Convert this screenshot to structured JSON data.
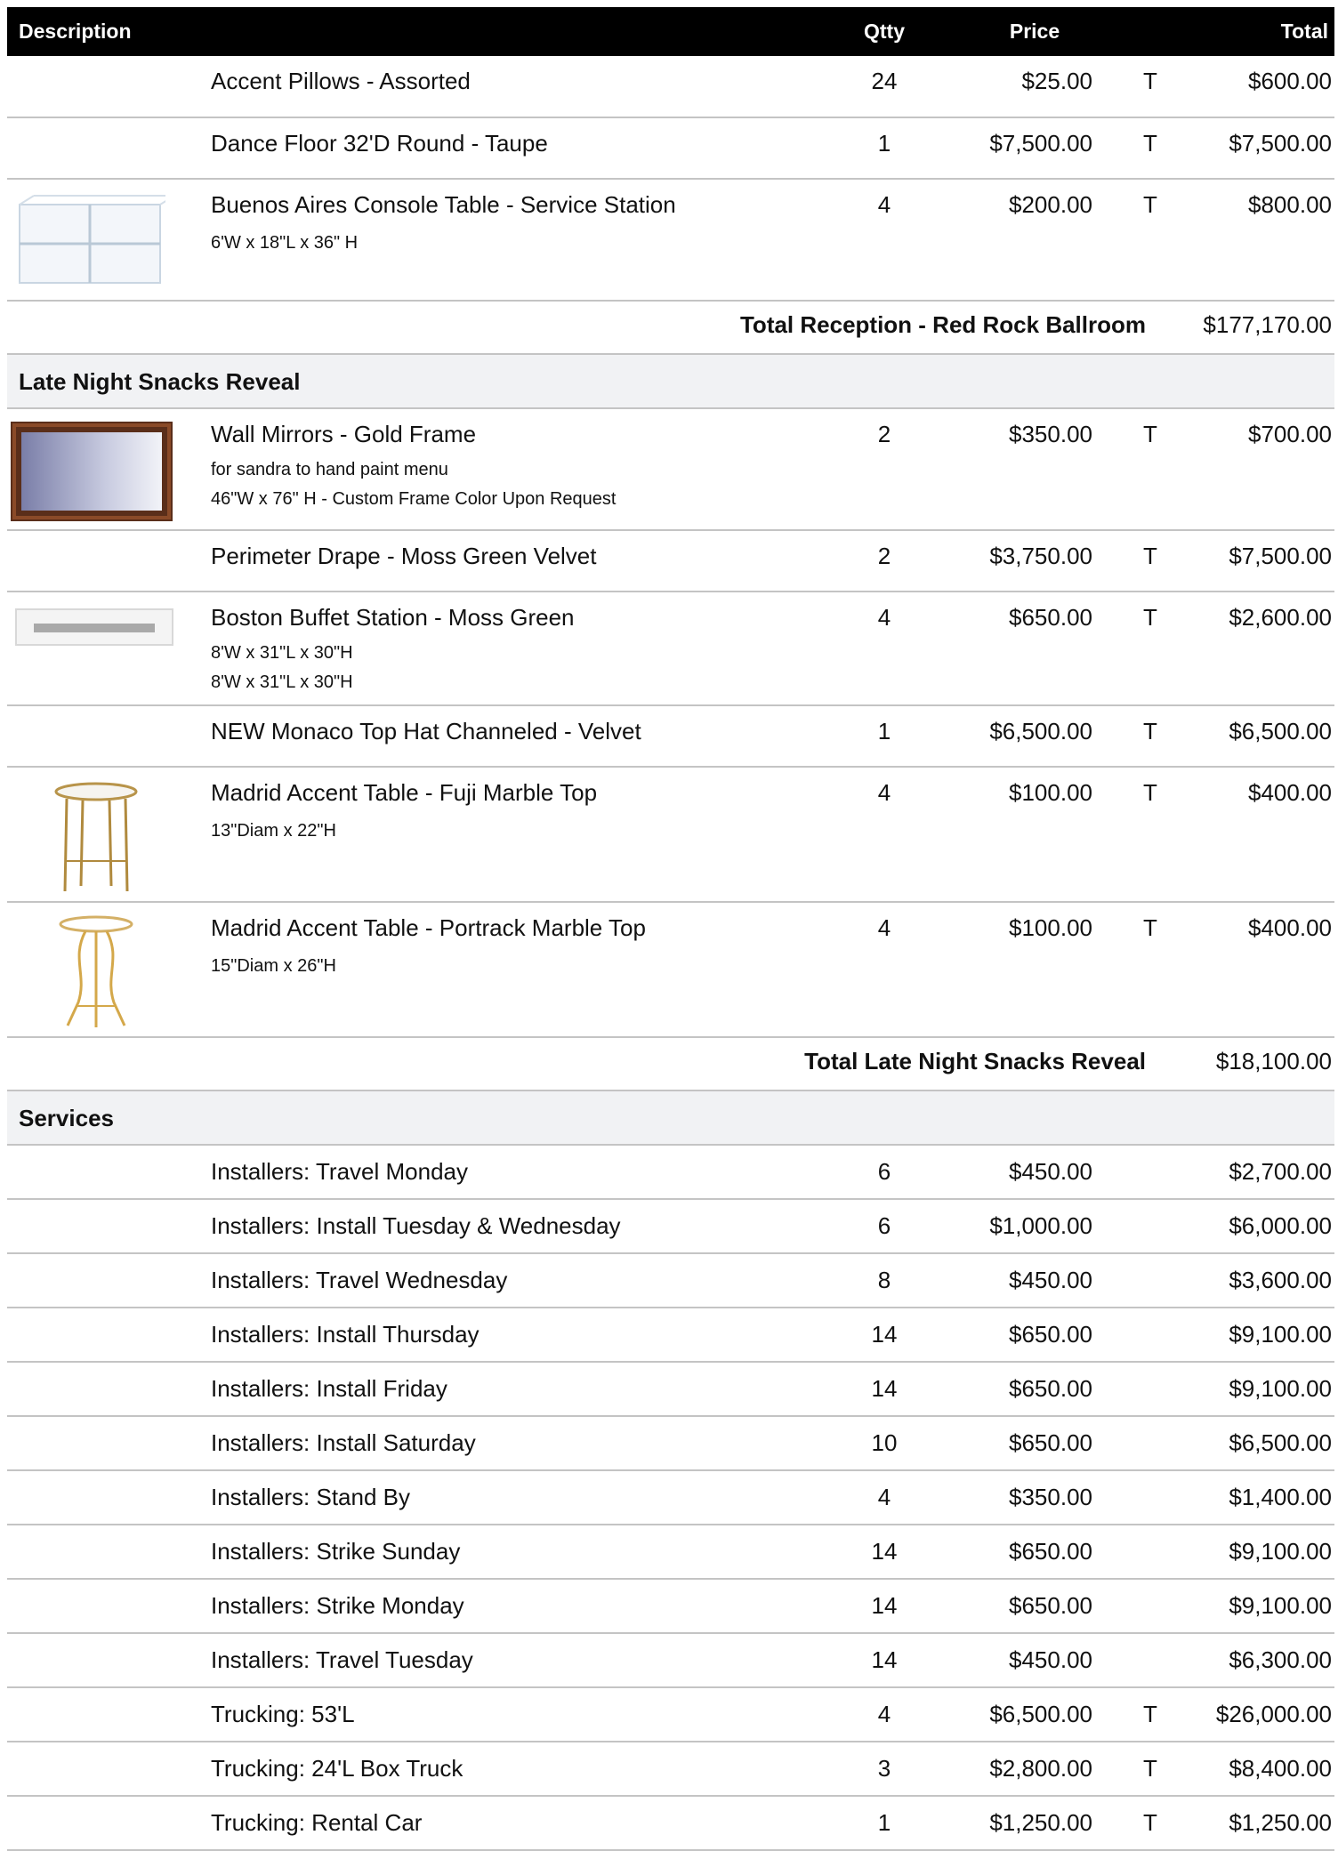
{
  "columns": {
    "description": "Description",
    "qty": "Qtty",
    "price": "Price",
    "total": "Total"
  },
  "reception_rows": [
    {
      "name": "Accent Pillows - Assorted",
      "qty": "24",
      "price": "$25.00",
      "tax": "T",
      "total": "$600.00"
    },
    {
      "name": "Dance Floor 32'D Round - Taupe",
      "qty": "1",
      "price": "$7,500.00",
      "tax": "T",
      "total": "$7,500.00"
    },
    {
      "name": "Buenos Aires Console Table - Service Station",
      "details": [
        "6'W x 18\"L x 36\" H"
      ],
      "qty": "4",
      "price": "$200.00",
      "tax": "T",
      "total": "$800.00",
      "image": "acrylic-console-table"
    }
  ],
  "reception_total": {
    "label": "Total Reception - Red Rock Ballroom",
    "amount": "$177,170.00"
  },
  "late_night": {
    "title": "Late Night Snacks Reveal",
    "rows": [
      {
        "name": "Wall Mirrors - Gold Frame",
        "details": [
          "for sandra to hand paint menu",
          "46\"W  x 76\" H - Custom Frame Color Upon Request"
        ],
        "qty": "2",
        "price": "$350.00",
        "tax": "T",
        "total": "$700.00",
        "image": "gold-frame-mirror"
      },
      {
        "name": "Perimeter Drape - Moss Green Velvet",
        "qty": "2",
        "price": "$3,750.00",
        "tax": "T",
        "total": "$7,500.00"
      },
      {
        "name": "Boston Buffet Station - Moss Green",
        "details": [
          "8'W x 31\"L x 30\"H",
          "8'W x 31\"L x 30\"H"
        ],
        "qty": "4",
        "price": "$650.00",
        "tax": "T",
        "total": "$2,600.00",
        "image": "buffet-station"
      },
      {
        "name": "NEW Monaco Top Hat Channeled - Velvet",
        "qty": "1",
        "price": "$6,500.00",
        "tax": "T",
        "total": "$6,500.00"
      },
      {
        "name": "Madrid Accent Table - Fuji Marble Top",
        "details": [
          "13\"Diam x 22\"H"
        ],
        "qty": "4",
        "price": "$100.00",
        "tax": "T",
        "total": "$400.00",
        "image": "accent-table-fuji"
      },
      {
        "name": "Madrid Accent Table - Portrack Marble Top",
        "details": [
          "15\"Diam x 26\"H"
        ],
        "qty": "4",
        "price": "$100.00",
        "tax": "T",
        "total": "$400.00",
        "image": "accent-table-portrack"
      }
    ],
    "total": {
      "label": "Total Late Night Snacks Reveal",
      "amount": "$18,100.00"
    }
  },
  "services": {
    "title": "Services",
    "rows": [
      {
        "name": "Installers: Travel Monday",
        "qty": "6",
        "price": "$450.00",
        "tax": "",
        "total": "$2,700.00"
      },
      {
        "name": "Installers: Install Tuesday & Wednesday",
        "qty": "6",
        "price": "$1,000.00",
        "tax": "",
        "total": "$6,000.00"
      },
      {
        "name": "Installers: Travel Wednesday",
        "qty": "8",
        "price": "$450.00",
        "tax": "",
        "total": "$3,600.00"
      },
      {
        "name": "Installers: Install Thursday",
        "qty": "14",
        "price": "$650.00",
        "tax": "",
        "total": "$9,100.00"
      },
      {
        "name": "Installers: Install Friday",
        "qty": "14",
        "price": "$650.00",
        "tax": "",
        "total": "$9,100.00"
      },
      {
        "name": "Installers: Install Saturday",
        "qty": "10",
        "price": "$650.00",
        "tax": "",
        "total": "$6,500.00"
      },
      {
        "name": "Installers: Stand By",
        "qty": "4",
        "price": "$350.00",
        "tax": "",
        "total": "$1,400.00"
      },
      {
        "name": "Installers: Strike Sunday",
        "qty": "14",
        "price": "$650.00",
        "tax": "",
        "total": "$9,100.00"
      },
      {
        "name": "Installers: Strike Monday",
        "qty": "14",
        "price": "$650.00",
        "tax": "",
        "total": "$9,100.00"
      },
      {
        "name": "Installers: Travel Tuesday",
        "qty": "14",
        "price": "$450.00",
        "tax": "",
        "total": "$6,300.00"
      },
      {
        "name": "Trucking: 53'L",
        "qty": "4",
        "price": "$6,500.00",
        "tax": "T",
        "total": "$26,000.00"
      },
      {
        "name": "Trucking: 24'L Box Truck",
        "qty": "3",
        "price": "$2,800.00",
        "tax": "T",
        "total": "$8,400.00"
      },
      {
        "name": "Trucking: Rental Car",
        "qty": "1",
        "price": "$1,250.00",
        "tax": "T",
        "total": "$1,250.00"
      }
    ]
  }
}
